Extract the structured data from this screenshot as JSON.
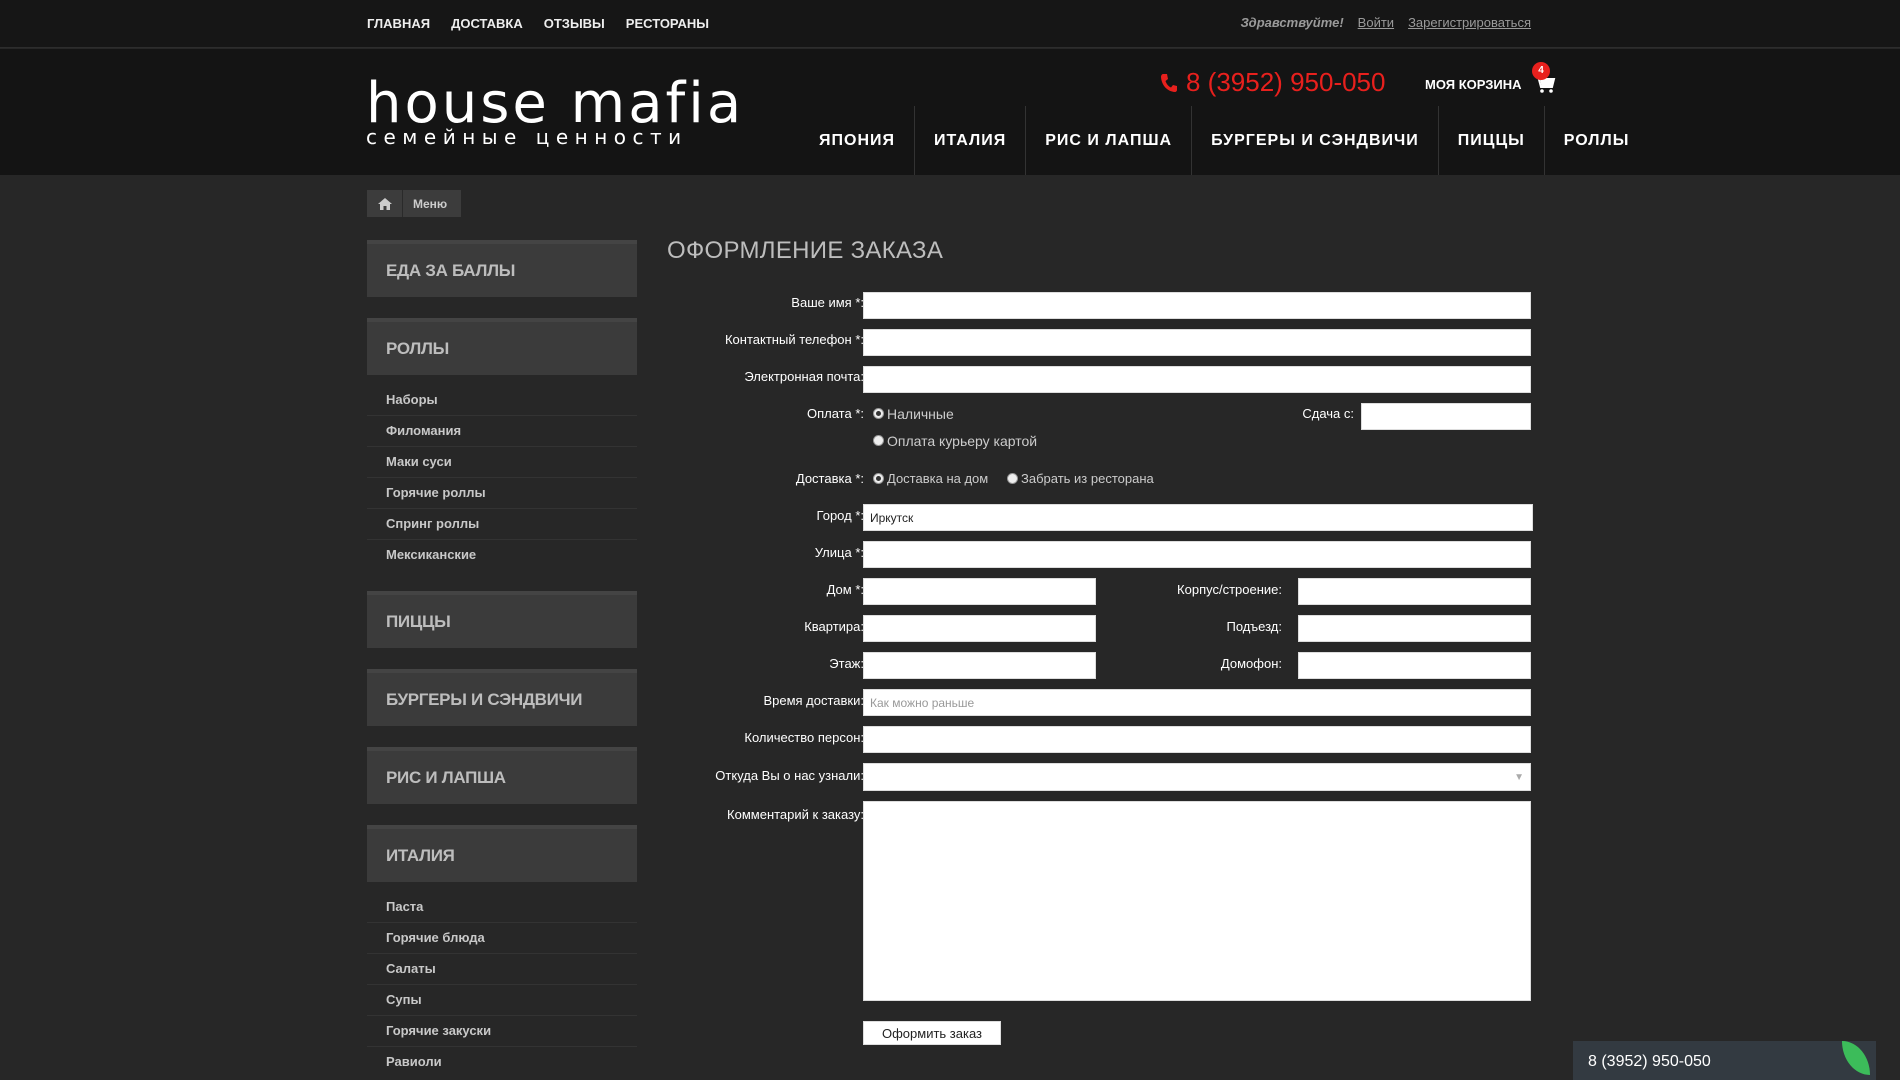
{
  "topbar": {
    "nav": [
      "ГЛАВНАЯ",
      "ДОСТАВКА",
      "ОТЗЫВЫ",
      "РЕСТОРАНЫ"
    ],
    "greeting": "Здравствуйте!",
    "login": "Войти",
    "register": "Зарегистрироваться"
  },
  "header": {
    "logo_main": "house mafia",
    "logo_sub": "семейные ценности",
    "phone": "8 (3952) 950-050",
    "cart_label": "МОЯ КОРЗИНА",
    "cart_count": "4",
    "nav": [
      "ЯПОНИЯ",
      "ИТАЛИЯ",
      "РИС И ЛАПША",
      "БУРГЕРЫ И СЭНДВИЧИ",
      "ПИЦЦЫ",
      "РОЛЛЫ"
    ]
  },
  "breadcrumb": {
    "label": "Меню"
  },
  "sidebar": {
    "food_points": "ЕДА ЗА БАЛЛЫ",
    "rolls": "РОЛЛЫ",
    "rolls_items": [
      "Наборы",
      "Филомания",
      "Маки суси",
      "Горячие роллы",
      "Спринг роллы",
      "Мексиканские"
    ],
    "pizza": "ПИЦЦЫ",
    "burgers": "БУРГЕРЫ И СЭНДВИЧИ",
    "rice": "РИС И ЛАПША",
    "italy": "ИТАЛИЯ",
    "italy_items": [
      "Паста",
      "Горячие блюда",
      "Салаты",
      "Супы",
      "Горячие закуски",
      "Равиоли"
    ]
  },
  "form": {
    "title": "ОФОРМЛЕНИЕ ЗАКАЗА",
    "name_label": "Ваше имя *:",
    "phone_label": "Контактный телефон *:",
    "email_label": "Электронная почта:",
    "payment_label": "Оплата *:",
    "payment_cash": "Наличные",
    "payment_card": "Оплата курьеру картой",
    "change_label": "Сдача с:",
    "delivery_label": "Доставка *:",
    "delivery_home": "Доставка на дом",
    "delivery_pickup": "Забрать из ресторана",
    "city_label": "Город *:",
    "city_value": "Иркутск",
    "street_label": "Улица *:",
    "house_label": "Дом *:",
    "building_label": "Корпус/строение:",
    "apartment_label": "Квартира:",
    "entrance_label": "Подъезд:",
    "floor_label": "Этаж:",
    "intercom_label": "Домофон:",
    "time_label": "Время доставки:",
    "time_placeholder": "Как можно раньше",
    "persons_label": "Количество персон:",
    "source_label": "Откуда Вы о нас узнали:",
    "comment_label": "Комментарий к заказу:",
    "submit": "Оформить заказ"
  },
  "widget": {
    "phone": "8 (3952) 950-050"
  },
  "colors": {
    "accent": "#e8201d",
    "bg": "#272727",
    "header": "#141414"
  }
}
